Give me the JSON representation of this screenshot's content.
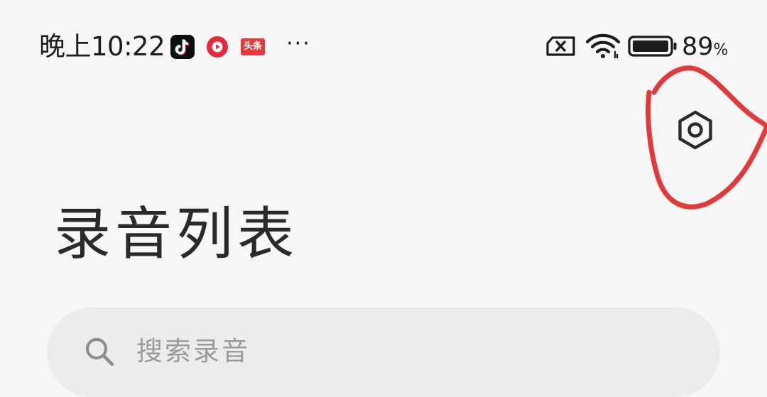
{
  "status_bar": {
    "time": "晚上10:22",
    "notification_icons": [
      "tiktok-icon",
      "video-app-icon",
      "toutiao-icon"
    ],
    "toutiao_label": "头条",
    "more_indicator": "···",
    "battery_value": "89",
    "battery_unit": "%",
    "battery_level": 0.89,
    "status_icons": [
      "no-sim-icon",
      "wifi-icon",
      "battery-icon"
    ]
  },
  "toolbar": {
    "settings_icon": "settings-hex-icon"
  },
  "annotation": {
    "color": "#e23a3a",
    "shape": "hand-drawn circle around settings icon"
  },
  "main": {
    "title": "录音列表"
  },
  "search": {
    "placeholder": "搜索录音",
    "icon": "search-icon"
  },
  "colors": {
    "background": "#f7f7f7",
    "search_background": "#ececec",
    "text": "#1f1f1f",
    "placeholder": "#9a9a9a",
    "annotation": "#e23a3a"
  }
}
